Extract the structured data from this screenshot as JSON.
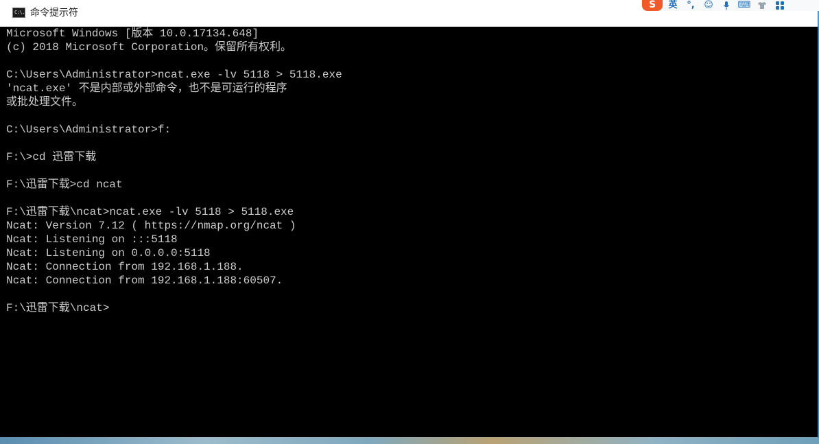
{
  "window": {
    "title": "命令提示符",
    "icon_text": "C:\\."
  },
  "ime_toolbar": {
    "logo": "S",
    "items": [
      {
        "name": "english-mode-icon",
        "label": "英"
      },
      {
        "name": "punctuation-icon",
        "label": "°,"
      },
      {
        "name": "emoji-icon",
        "label": "☺"
      },
      {
        "name": "voice-input-icon",
        "label": "🎤"
      },
      {
        "name": "keyboard-icon",
        "label": "⌨"
      },
      {
        "name": "skin-icon",
        "label": "👕"
      },
      {
        "name": "tools-icon",
        "label": "⊞"
      }
    ]
  },
  "console": {
    "lines": [
      "Microsoft Windows [版本 10.0.17134.648]",
      "(c) 2018 Microsoft Corporation。保留所有权利。",
      "",
      "C:\\Users\\Administrator>ncat.exe -lv 5118 > 5118.exe",
      "'ncat.exe' 不是内部或外部命令，也不是可运行的程序",
      "或批处理文件。",
      "",
      "C:\\Users\\Administrator>f:",
      "",
      "F:\\>cd 迅雷下载",
      "",
      "F:\\迅雷下载>cd ncat",
      "",
      "F:\\迅雷下载\\ncat>ncat.exe -lv 5118 > 5118.exe",
      "Ncat: Version 7.12 ( https://nmap.org/ncat )",
      "Ncat: Listening on :::5118",
      "Ncat: Listening on 0.0.0.0:5118",
      "Ncat: Connection from 192.168.1.188.",
      "Ncat: Connection from 192.168.1.188:60507.",
      "",
      "F:\\迅雷下载\\ncat>"
    ]
  }
}
